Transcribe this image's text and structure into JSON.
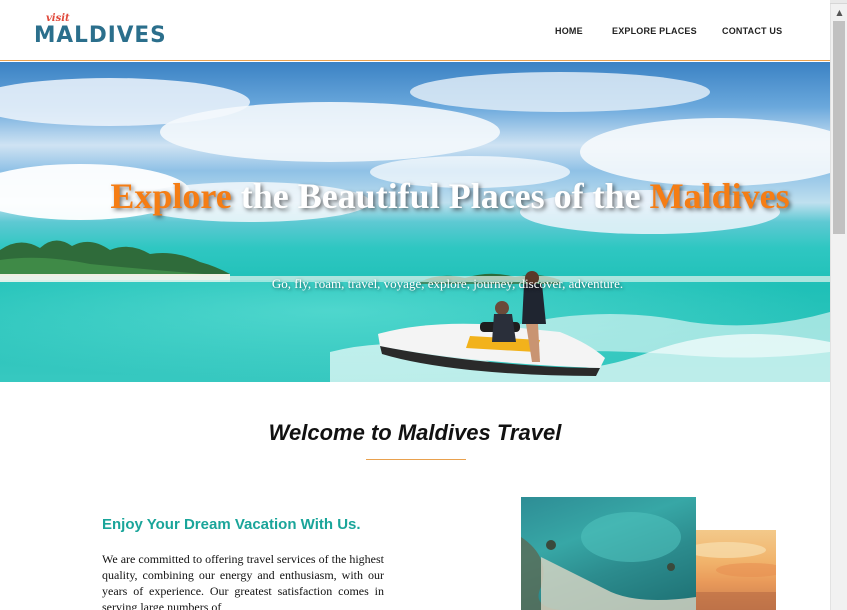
{
  "logo": {
    "small": "visit",
    "main": "MALDIVES"
  },
  "nav": {
    "home": "HOME",
    "explore": "EXPLORE PLACES",
    "contact": "CONTACT US"
  },
  "hero": {
    "title_highlight_1": "Explore",
    "title_middle": " the Beautiful Places of the ",
    "title_highlight_2": "Maldives",
    "subtitle": "Go, fly, roam, travel, voyage, explore, journey, discover, adventure."
  },
  "welcome": {
    "title": "Welcome to Maldives Travel"
  },
  "intro": {
    "heading": "Enjoy Your Dream Vacation With Us.",
    "paragraph": "We are committed to offering travel services of the highest quality, combining our energy and enthusiasm, with our years of experience. Our greatest satisfaction comes in serving large numbers of"
  },
  "colors": {
    "accent_orange": "#f57d14",
    "teal_heading": "#1aa59a",
    "logo_blue": "#2b6f8c",
    "logo_red": "#e0493b"
  },
  "icons": {
    "scroll_up": "scroll-up-arrow-icon"
  }
}
